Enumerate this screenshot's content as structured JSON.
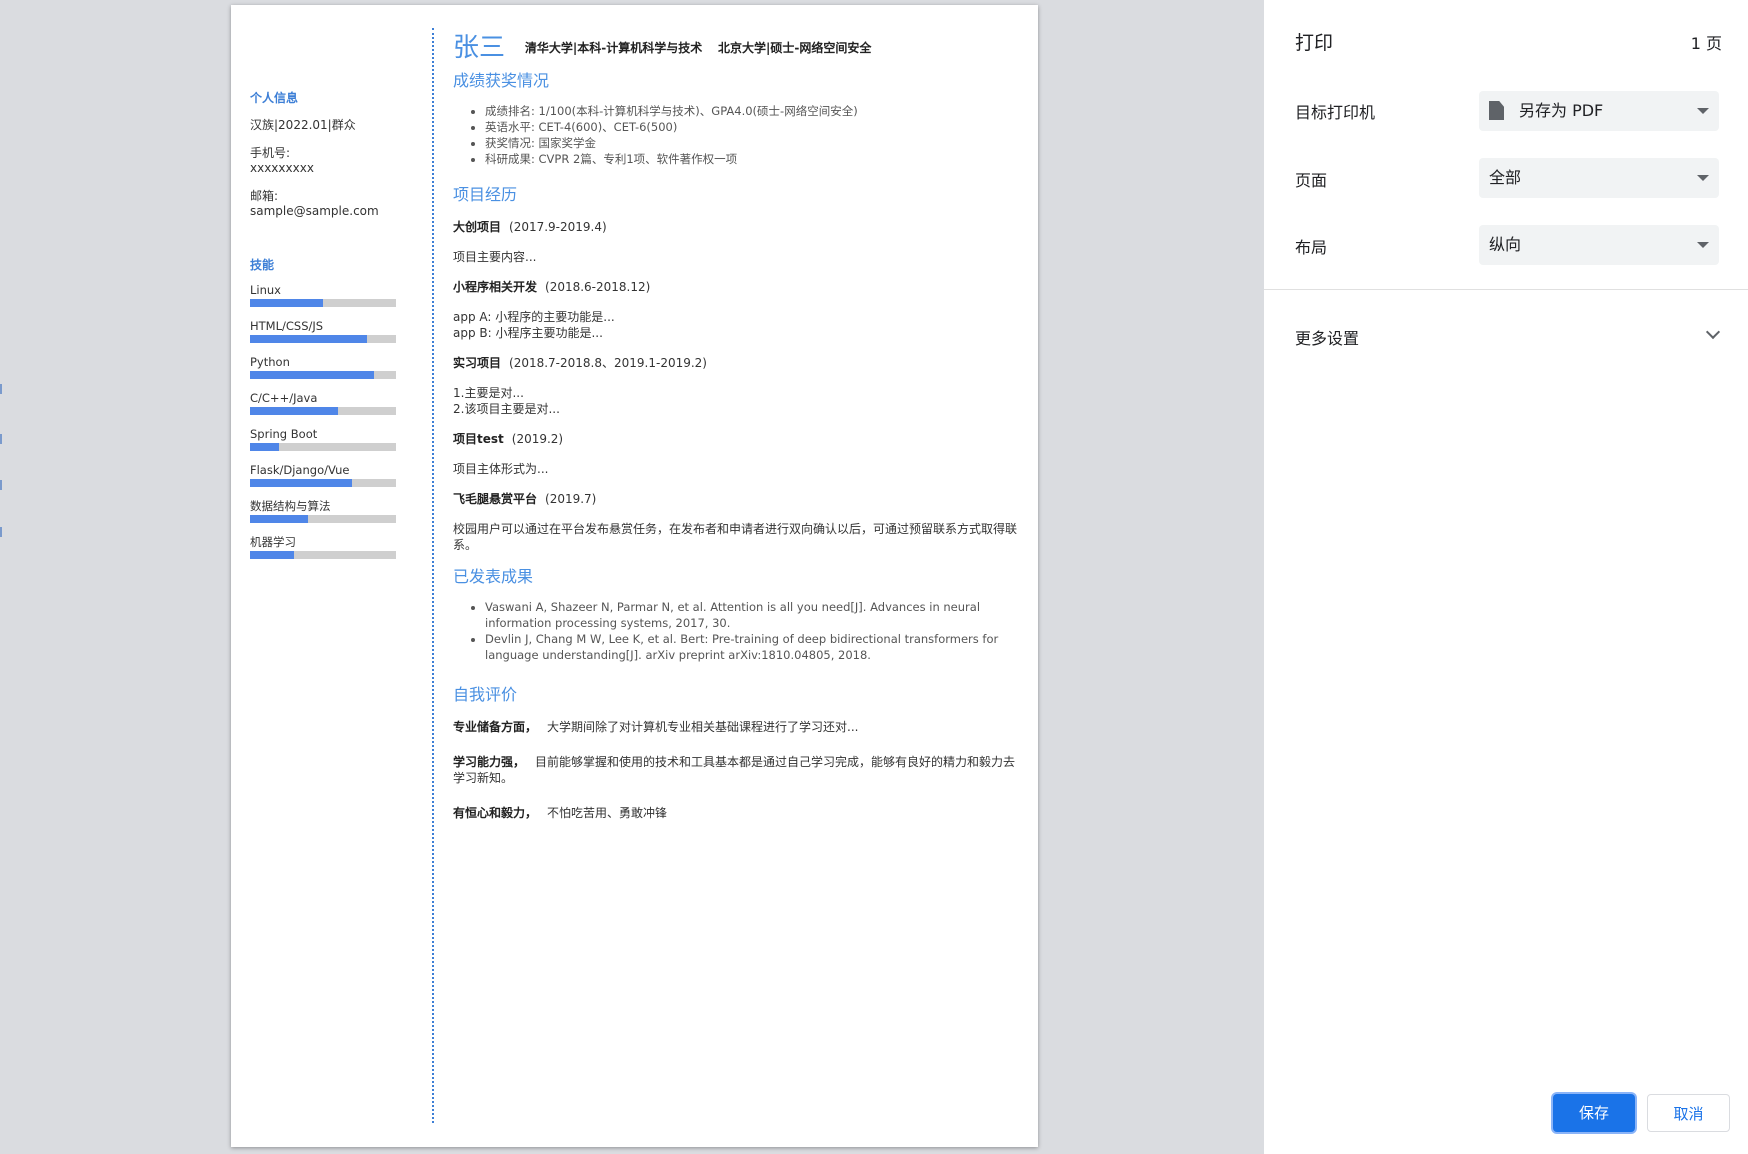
{
  "resume": {
    "name": "张三",
    "schools": [
      "清华大学|本科-计算机科学与技术",
      "北京大学|硕士-网络空间安全"
    ],
    "sidebar": {
      "personal_title": "个人信息",
      "ethnicity_line": "汉族|2022.01|群众",
      "phone_label": "手机号:",
      "phone_value": "xxxxxxxxx",
      "email_label": "邮箱:",
      "email_value": "sample@sample.com",
      "skills_title": "技能",
      "skills": [
        {
          "name": "Linux",
          "level": 0.5
        },
        {
          "name": "HTML/CSS/JS",
          "level": 0.8
        },
        {
          "name": "Python",
          "level": 0.85
        },
        {
          "name": "C/C++/Java",
          "level": 0.6
        },
        {
          "name": "Spring Boot",
          "level": 0.2
        },
        {
          "name": "Flask/Django/Vue",
          "level": 0.7
        },
        {
          "name": "数据结构与算法",
          "level": 0.4
        },
        {
          "name": "机器学习",
          "level": 0.3
        }
      ]
    },
    "awards": {
      "title": "成绩获奖情况",
      "items": [
        "成绩排名: 1/100(本科-计算机科学与技术)、GPA4.0(硕士-网络空间安全)",
        "英语水平: CET-4(600)、CET-6(500)",
        "获奖情况: 国家奖学金",
        "科研成果: CVPR 2篇、专利1项、软件著作权一项"
      ]
    },
    "projects": {
      "title": "项目经历",
      "items": [
        {
          "name": "大创项目",
          "date": "(2017.9-2019.4)",
          "desc": [
            "项目主要内容..."
          ]
        },
        {
          "name": "小程序相关开发",
          "date": "(2018.6-2018.12)",
          "desc": [
            "app A: 小程序的主要功能是...",
            "app B: 小程序主要功能是..."
          ]
        },
        {
          "name": "实习项目",
          "date": "(2018.7-2018.8、2019.1-2019.2)",
          "desc": [
            "1.主要是对...",
            "2.该项目主要是对..."
          ]
        },
        {
          "name": "项目test",
          "date": "(2019.2)",
          "desc": [
            "项目主体形式为..."
          ]
        },
        {
          "name": "飞毛腿悬赏平台",
          "date": "(2019.7)",
          "desc": [
            "校园用户可以通过在平台发布悬赏任务，在发布者和申请者进行双向确认以后，可通过预留联系方式取得联系。"
          ]
        }
      ]
    },
    "publications": {
      "title": "已发表成果",
      "items": [
        "Vaswani A, Shazeer N, Parmar N, et al. Attention is all you need[J]. Advances in neural information processing systems, 2017, 30.",
        "Devlin J, Chang M W, Lee K, et al. Bert: Pre-training of deep bidirectional transformers for language understanding[J]. arXiv preprint arXiv:1810.04805, 2018."
      ]
    },
    "self_eval": {
      "title": "自我评价",
      "items": [
        {
          "label": "专业储备方面，",
          "text": "大学期间除了对计算机专业相关基础课程进行了学习还对..."
        },
        {
          "label": "学习能力强，",
          "text": "目前能够掌握和使用的技术和工具基本都是通过自己学习完成，能够有良好的精力和毅力去学习新知。"
        },
        {
          "label": "有恒心和毅力，",
          "text": "不怕吃苦用、勇敢冲锋"
        }
      ]
    }
  },
  "print_panel": {
    "title": "打印",
    "page_count": "1 页",
    "destination_label": "目标打印机",
    "destination_value": "另存为 PDF",
    "pages_label": "页面",
    "pages_value": "全部",
    "layout_label": "布局",
    "layout_value": "纵向",
    "more_settings": "更多设置",
    "save": "保存",
    "cancel": "取消"
  },
  "colors": {
    "accent": "#1a73e8",
    "resume_blue": "#4a90e2",
    "skill_fill": "#4f86e8",
    "skill_track": "#cfcfcf"
  }
}
